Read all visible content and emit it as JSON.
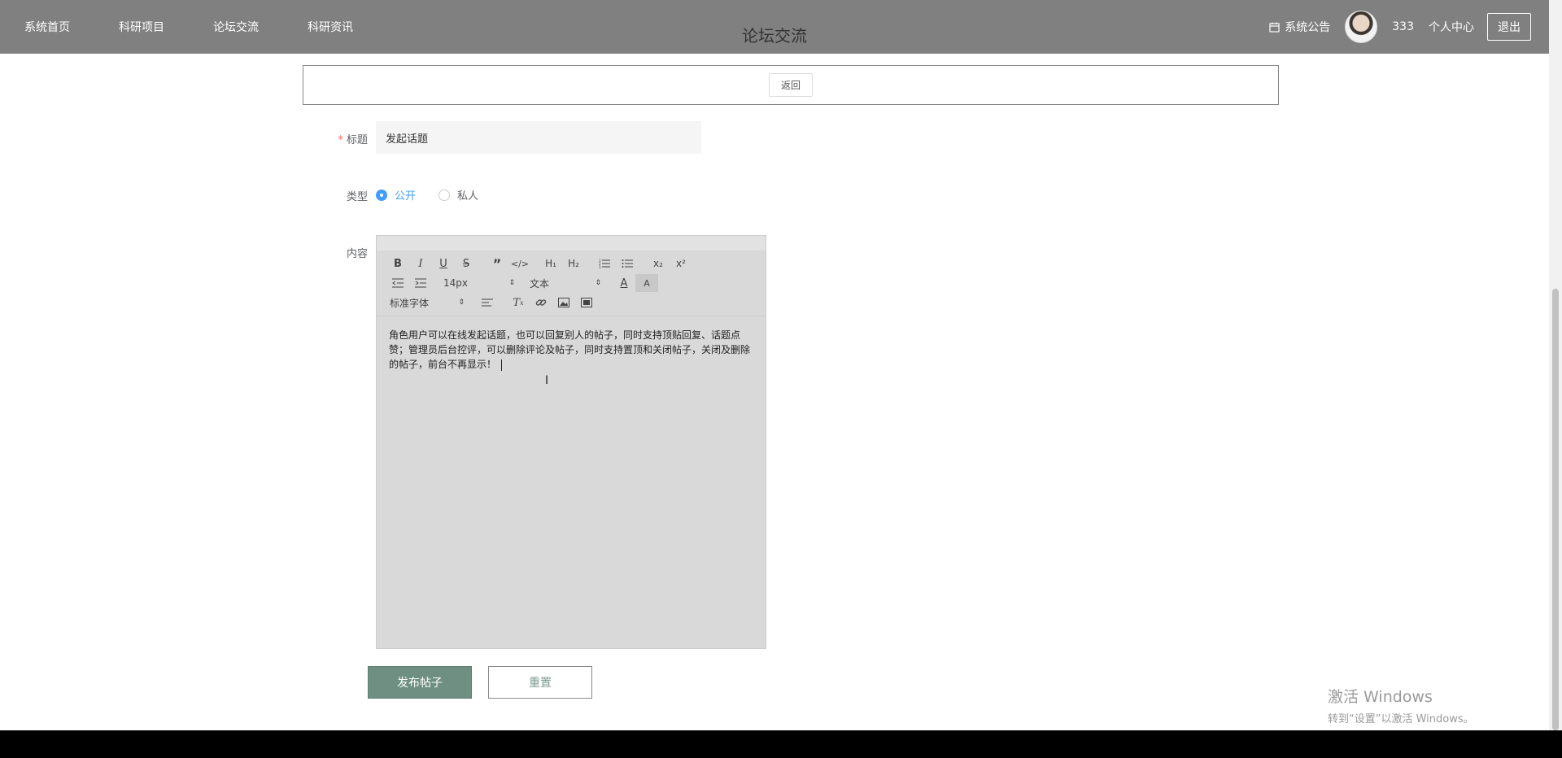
{
  "nav": {
    "items": [
      "系统首页",
      "科研项目",
      "论坛交流",
      "科研资讯"
    ],
    "page_title": "论坛交流",
    "notice_label": "系统公告",
    "username": "333",
    "user_center_label": "个人中心",
    "logout_label": "退出"
  },
  "back_label": "返回",
  "form": {
    "title_label": "标题",
    "title_value": "发起话题",
    "type_label": "类型",
    "type_options": [
      "公开",
      "私人"
    ],
    "type_selected": "公开",
    "content_label": "内容",
    "editor": {
      "font_size": "14px",
      "header_select": "文本",
      "font_family": "标准字体",
      "content": "角色用户可以在线发起话题，也可以回复别人的帖子，同时支持顶贴回复、话题点赞；管理员后台控评，可以删除评论及帖子，同时支持置顶和关闭帖子，关闭及删除的帖子，前台不再显示！"
    },
    "submit_label": "发布帖子",
    "reset_label": "重置"
  },
  "watermark": {
    "title": "激活 Windows",
    "subtitle": "转到“设置”以激活 Windows。"
  },
  "colors": {
    "header_bg": "#808080",
    "submit_bg": "#6e8f82",
    "accent_blue": "#409eff",
    "editor_bg": "#d9d9d9"
  }
}
